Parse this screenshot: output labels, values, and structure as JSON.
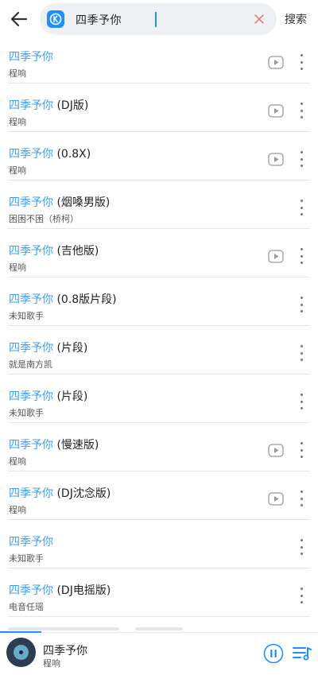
{
  "header": {
    "query": "四季予你",
    "search_button": "搜索"
  },
  "colors": {
    "accent": "#1e90ff",
    "highlight": "#3d9ff0"
  },
  "results": [
    {
      "highlight": "四季予你",
      "suffix": "",
      "artist": "程响",
      "has_video": true
    },
    {
      "highlight": "四季予你",
      "suffix": " (DJ版)",
      "artist": "程响",
      "has_video": true
    },
    {
      "highlight": "四季予你",
      "suffix": " (0.8X)",
      "artist": "程响",
      "has_video": true
    },
    {
      "highlight": "四季予你",
      "suffix": " (烟嗓男版)",
      "artist": "困困不困（桥柯）",
      "has_video": false
    },
    {
      "highlight": "四季予你",
      "suffix": " (吉他版)",
      "artist": "程响",
      "has_video": true
    },
    {
      "highlight": "四季予你",
      "suffix": " (0.8版片段)",
      "artist": "未知歌手",
      "has_video": false
    },
    {
      "highlight": "四季予你",
      "suffix": " (片段)",
      "artist": "就是南方凯",
      "has_video": false
    },
    {
      "highlight": "四季予你",
      "suffix": " (片段)",
      "artist": "未知歌手",
      "has_video": false
    },
    {
      "highlight": "四季予你",
      "suffix": " (慢速版)",
      "artist": "程响",
      "has_video": true
    },
    {
      "highlight": "四季予你",
      "suffix": " (DJ沈念版)",
      "artist": "程响",
      "has_video": true
    },
    {
      "highlight": "四季予你",
      "suffix": "",
      "artist": "未知歌手",
      "has_video": false
    },
    {
      "highlight": "四季予你",
      "suffix": " (DJ电摇版)",
      "artist": "电音任瑶",
      "has_video": false
    }
  ],
  "player": {
    "title": "四季予你",
    "artist": "程响"
  }
}
